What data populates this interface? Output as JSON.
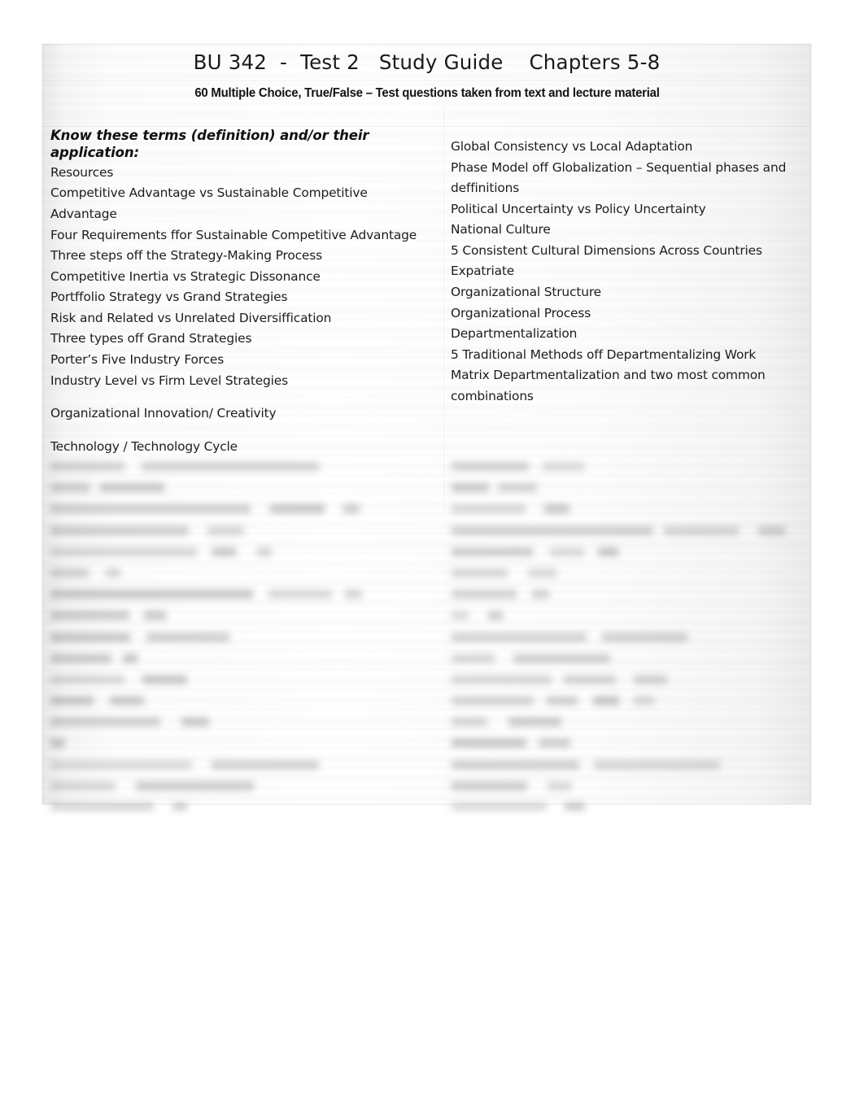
{
  "document": {
    "title": "BU 342  -  Test 2   Study Guide    Chapters 5-8",
    "subtitle": "60 Multiple Choice, True/False – Test questions taken from text and lecture material"
  },
  "table": {
    "left_column": {
      "heading": "Know these terms (definition) and/or their application:",
      "items": [
        "Resources",
        "Competitive Advantage vs Sustainable Competitive Advantage",
        "Four Requirements ffor Sustainable Competitive Advantage",
        "Three steps off the Strategy-Making Process",
        "Competitive Inertia vs Strategic Dissonance",
        "Portffolio Strategy vs Grand Strategies",
        "Risk and Related vs Unrelated Diversiffication",
        "Three types off Grand Strategies",
        "Porter’s Five Industry Forces",
        "Industry Level vs Firm Level Strategies",
        "Organizational Innovation/ Creativity",
        "Technology / Technology Cycle"
      ]
    },
    "right_column": {
      "heading": "",
      "items": [
        "Global Consistency vs Local Adaptation",
        "Phase Model off Globalization – Sequential phases and deffinitions",
        "Political Uncertainty vs Policy Uncertainty",
        "National Culture",
        "5 Consistent Cultural Dimensions Across Countries",
        "Expatriate",
        "Organizational Structure",
        "Organizational Process",
        "Departmentalization",
        "5 Traditional Methods off Departmentalizing Work",
        "Matrix Departmentalization and two most common combinations"
      ]
    }
  },
  "redacted_region": {
    "note": "Lower portion of the study guide is blurred and illegible",
    "left_line_widths": [
      330,
      140,
      380,
      270,
      280,
      100,
      400,
      170,
      220,
      120,
      200,
      150,
      215,
      18,
      330,
      250,
      190
    ],
    "right_line_widths": [
      190,
      105,
      145,
      410,
      205,
      130,
      120,
      70,
      290,
      195,
      265,
      250,
      135,
      165,
      330,
      160,
      175
    ]
  },
  "colors": {
    "page_background": "#ffffff",
    "sheet_background": "#fdfdfd",
    "text": "#1d1d1d",
    "heading_text": "#111111",
    "border": "#f0f0f0"
  }
}
